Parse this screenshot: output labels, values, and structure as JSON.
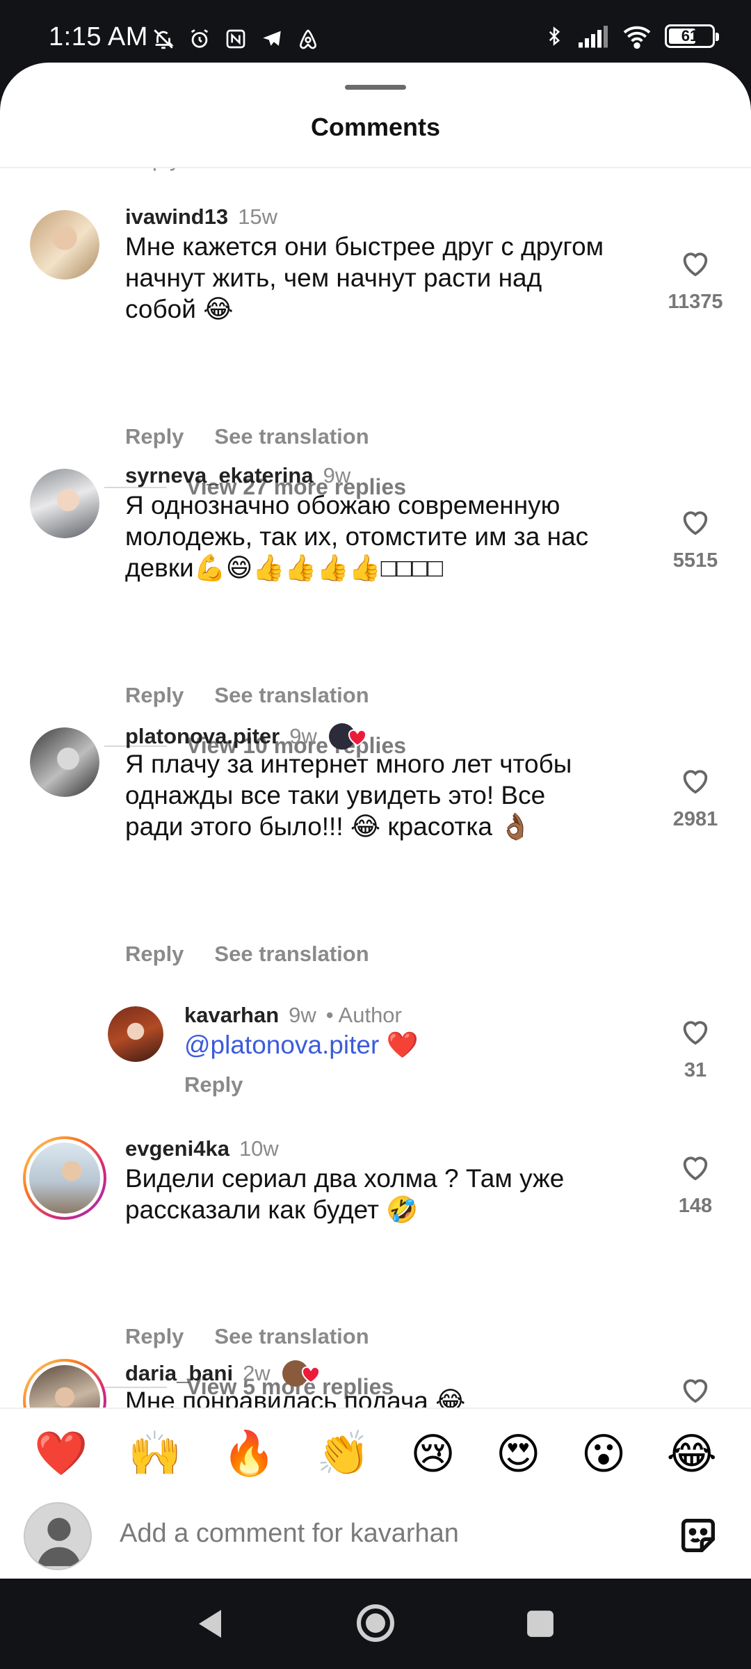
{
  "status_bar": {
    "time": "1:15 AM",
    "battery": "61",
    "left_icons": [
      "mute-icon",
      "alarm-icon",
      "nfc-icon",
      "telegram-icon",
      "airbnb-icon"
    ],
    "right_icons": [
      "bluetooth-icon",
      "signal-icon",
      "wifi-icon",
      "battery-icon"
    ]
  },
  "sheet": {
    "title": "Comments"
  },
  "labels": {
    "reply": "Reply",
    "see_translation": "See translation"
  },
  "comments": [
    {
      "username": "ivawind13",
      "time": "15w",
      "text_lines": [
        "Мне кажется они быстрее друг с другом",
        "начнут жить, чем начнут расти над",
        "собой 😂"
      ],
      "likes": "11375",
      "view_more": "View 27 more replies"
    },
    {
      "username": "syrneva_ekaterina",
      "time": "9w",
      "text_lines": [
        "Я однозначно обожаю современную",
        "молодежь, так их, отомстите им за нас",
        "девки💪😄👍👍👍👍□□□□"
      ],
      "likes": "5515",
      "view_more": "View 10 more replies"
    },
    {
      "username": "platonova.piter",
      "time": "9w",
      "text_lines": [
        "Я плачу за интернет много лет чтобы",
        "однажды все таки увидеть это! Все",
        "ради этого было!!! 😂 красотка 👌🏾"
      ],
      "likes": "2981"
    },
    {
      "username": "kavarhan",
      "time": "9w",
      "author_label": "• Author",
      "mention": "@platonova.piter",
      "text_suffix": " ❤️",
      "likes": "31"
    },
    {
      "username": "evgeni4ka",
      "time": "10w",
      "text_lines": [
        "Видели сериал два холма ? Там уже",
        "рассказали как будет 🤣"
      ],
      "likes": "148",
      "view_more": "View 5 more replies"
    },
    {
      "username": "daria_bani",
      "time": "2w",
      "text_lines": [
        "Мне понравилась подача 😂"
      ]
    }
  ],
  "reactions": [
    "❤️",
    "🙌",
    "🔥",
    "👏",
    "😢",
    "😍",
    "😮",
    "😂"
  ],
  "composer": {
    "placeholder": "Add a comment for kavarhan"
  },
  "colors": {
    "mention": "#3b5bdb",
    "like_red": "#ed4956",
    "status_bg": "#121316"
  }
}
